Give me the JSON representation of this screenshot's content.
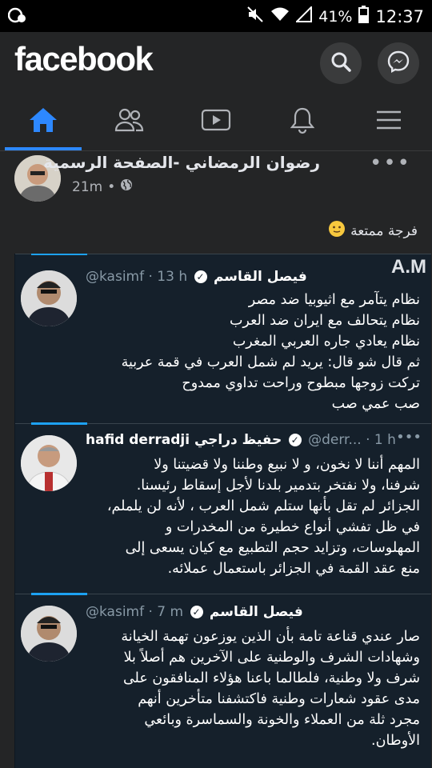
{
  "status_bar": {
    "battery": "41%",
    "time": "12:37"
  },
  "header": {
    "logo": "facebook"
  },
  "nav": {
    "tabs": [
      "home",
      "friends",
      "watch",
      "notifications",
      "menu"
    ]
  },
  "post": {
    "author": "رضوان الرمضاني -الصفحة الرسمية",
    "time": "21m",
    "text": "فرجة ممتعة"
  },
  "screenshot": {
    "watermark": "A.M",
    "tweets": [
      {
        "name": "فيصل القاسم",
        "handle": "@kasimf · 13 h",
        "lines": [
          "نظام  يتآمر مع اثيوبيا ضد مصر",
          "نظام يتحالف مع ايران ضد العرب",
          "نظام يعادي جاره العربي المغرب",
          "ثم قال شو قال: يريد لم شمل العرب في قمة عربية",
          "تركت زوجها مبطوح وراحت تداوي ممدوح",
          "صب عمي صب"
        ]
      },
      {
        "name": "hafid derradji حفيظ دراجي",
        "handle": "@derr... · 1 h",
        "lines": [
          "المهم أننا لا نخون، و لا نبيع وطننا ولا قضيتنا ولا",
          "شرفنا، ولا نفتخر بتدمير بلدنا لأجل إسقاط رئيسنا.",
          "الجزائر لم تقل بأنها ستلم شمل العرب ، لأنه لن يلملم،",
          "في ظل تفشي أنواع خطيرة من المخدرات و",
          "المهلوسات، وتزايد حجم التطبيع مع كيان يسعى إلى",
          "منع عقد القمة في الجزائر باستعمال عملائه."
        ]
      },
      {
        "name": "فيصل القاسم",
        "handle": "@kasimf · 7 m",
        "lines": [
          "صار عندي قناعة تامة بأن الذين يوزعون تهمة الخيانة",
          "وشهادات الشرف والوطنية على الآخرين هم أصلاً بلا",
          "شرف ولا وطنية، فلطالما باعنا هؤلاء المنافقون على",
          "مدى عقود شعارات وطنية فاكتشفنا متأخرين أنهم",
          "مجرد ثلة من العملاء والخونة والسماسرة وبائعي",
          "الأوطان."
        ]
      }
    ]
  }
}
